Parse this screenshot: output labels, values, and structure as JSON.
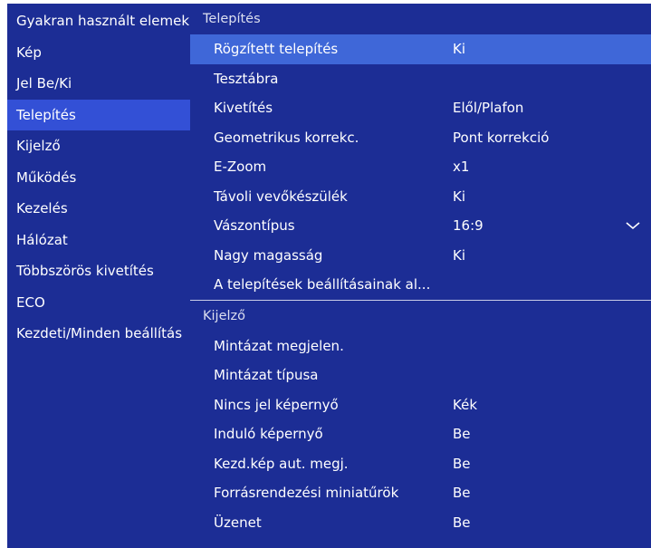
{
  "sidebar": {
    "items": [
      {
        "label": "Gyakran használt elemek"
      },
      {
        "label": "Kép"
      },
      {
        "label": "Jel Be/Ki"
      },
      {
        "label": "Telepítés"
      },
      {
        "label": "Kijelző"
      },
      {
        "label": "Működés"
      },
      {
        "label": "Kezelés"
      },
      {
        "label": "Hálózat"
      },
      {
        "label": "Többszörös kivetítés"
      },
      {
        "label": "ECO"
      },
      {
        "label": "Kezdeti/Minden beállítás"
      }
    ],
    "active_index": 3
  },
  "panel": {
    "install_header": "Telepítés",
    "install_rows": [
      {
        "name": "Rögzített telepítés",
        "value": "Ki"
      },
      {
        "name": "Tesztábra",
        "value": ""
      },
      {
        "name": "Kivetítés",
        "value": "Elől/Plafon"
      },
      {
        "name": "Geometrikus korrekc.",
        "value": "Pont korrekció"
      },
      {
        "name": "E-Zoom",
        "value": "x1"
      },
      {
        "name": "Távoli vevőkészülék",
        "value": "Ki"
      },
      {
        "name": "Vászontípus",
        "value": "16:9"
      },
      {
        "name": "Nagy magasság",
        "value": "Ki"
      },
      {
        "name": "A telepítések beállításainak al...",
        "value": ""
      }
    ],
    "display_header": "Kijelző",
    "display_rows": [
      {
        "name": "Mintázat megjelen.",
        "value": ""
      },
      {
        "name": "Mintázat típusa",
        "value": ""
      },
      {
        "name": "Nincs jel képernyő",
        "value": "Kék"
      },
      {
        "name": "Induló képernyő",
        "value": "Be"
      },
      {
        "name": "Kezd.kép aut. megj.",
        "value": "Be"
      },
      {
        "name": "Forrásrendezési miniatűrök",
        "value": "Be"
      },
      {
        "name": "Üzenet",
        "value": "Be"
      }
    ]
  },
  "colors": {
    "background": "#1c2d95",
    "sidebar_active": "#3350d6",
    "row_active": "#3f67d8"
  },
  "icons": {
    "dropdown": "chevron-down-icon"
  }
}
